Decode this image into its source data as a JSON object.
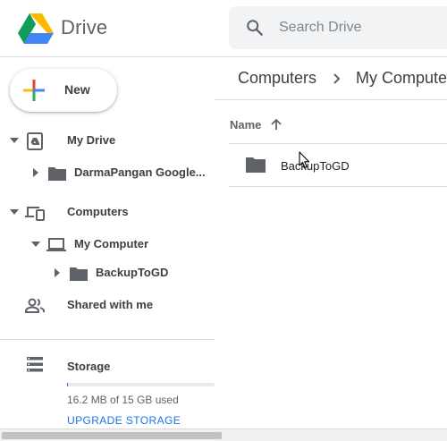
{
  "header": {
    "logo_icon": "google-drive-logo",
    "title": "Drive",
    "search": {
      "icon": "search-icon",
      "placeholder": "Search Drive",
      "value": ""
    }
  },
  "sidebar": {
    "new_button": {
      "label": "New",
      "icon": "plus-icon"
    },
    "tree": [
      {
        "label": "My Drive",
        "icon": "my-drive-icon",
        "expanded": true,
        "level": 0
      },
      {
        "label": "DarmaPangan Google...",
        "icon": "folder-icon",
        "expanded": false,
        "level": 1
      },
      {
        "label": "Computers",
        "icon": "computers-icon",
        "expanded": true,
        "level": 0
      },
      {
        "label": "My Computer",
        "icon": "laptop-icon",
        "expanded": true,
        "level": 1
      },
      {
        "label": "BackupToGD",
        "icon": "folder-icon",
        "expanded": false,
        "level": 2
      },
      {
        "label": "Shared with me",
        "icon": "people-icon",
        "level": 0
      }
    ],
    "storage": {
      "label": "Storage",
      "icon": "storage-icon",
      "used_text": "16.2 MB of 15 GB used",
      "used_fraction": 0.001,
      "upgrade_label": "UPGRADE STORAGE"
    }
  },
  "main": {
    "breadcrumb": [
      "Computers",
      "My Computer"
    ],
    "column_header": {
      "label": "Name",
      "sort": "ascending"
    },
    "files": [
      {
        "name": "BackupToGD",
        "icon": "folder-icon"
      }
    ]
  },
  "colors": {
    "accent": "#1a73e8",
    "text": "#3c4043",
    "icon": "#5f6368",
    "border": "#dadce0",
    "search_bg": "#f1f3f4"
  }
}
